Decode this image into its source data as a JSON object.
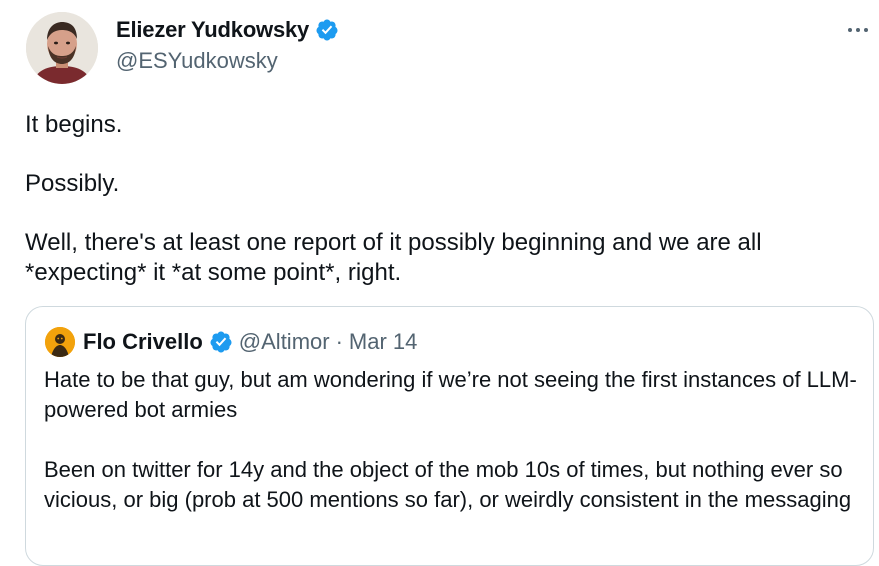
{
  "tweet": {
    "author": {
      "name": "Eliezer Yudkowsky",
      "handle": "@ESYudkowsky",
      "verified": true,
      "avatar_icon": "profile-photo"
    },
    "more_icon": "more-horizontal-icon",
    "paragraphs": [
      "It begins.",
      "Possibly.",
      "Well, there's at least one report of it possibly beginning and we are all *expecting* it *at some point*, right."
    ],
    "quote": {
      "author": {
        "name": "Flo Crivello",
        "handle": "@Altimor",
        "verified": true
      },
      "separator": "·",
      "date": "Mar 14",
      "paragraphs": [
        "Hate to be that guy, but am wondering if we’re not seeing the first instances of LLM-powered bot armies",
        "Been on twitter for 14y and the object of the mob 10s of times, but nothing ever so vicious, or big (prob at 500 mentions so far), or weirdly consistent in the messaging"
      ]
    }
  },
  "colors": {
    "verified_badge": "#1d9bf0",
    "primary_text": "#0f1419",
    "secondary_text": "#536471",
    "border": "#cfd9de"
  }
}
